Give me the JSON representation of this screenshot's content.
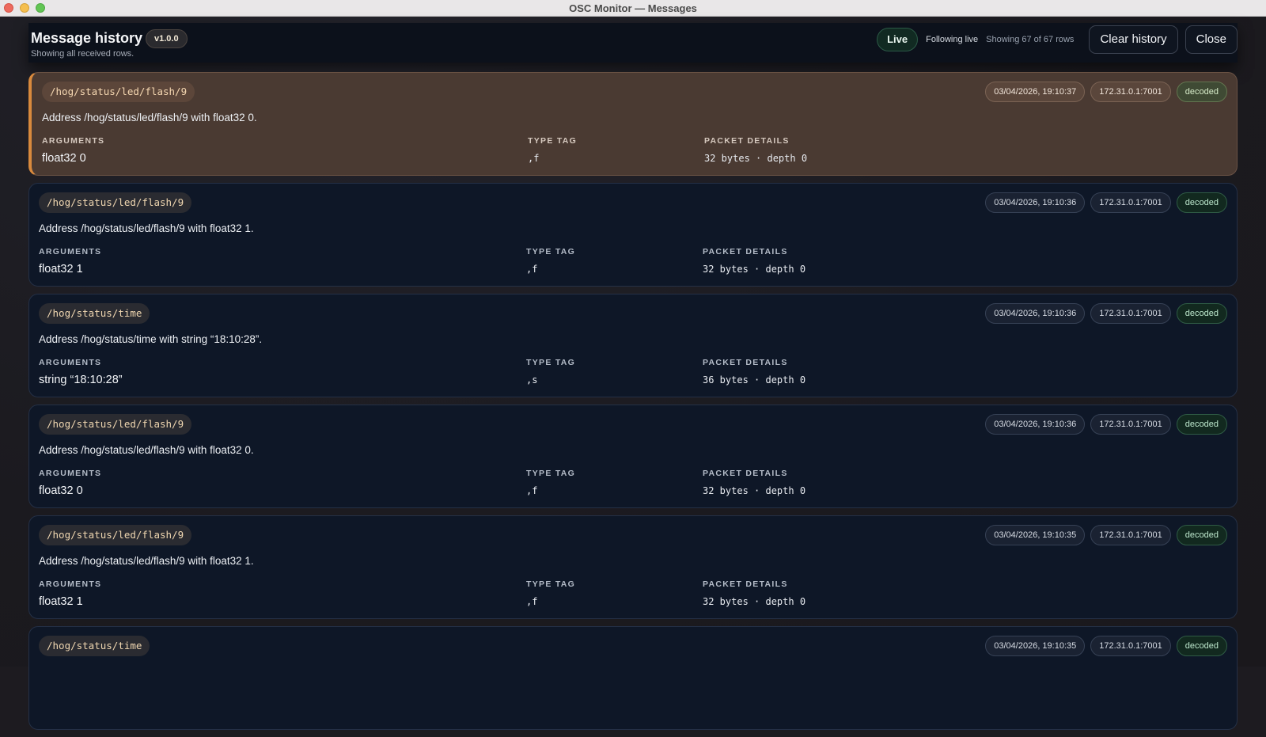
{
  "window": {
    "title": "OSC Monitor — Messages"
  },
  "header": {
    "title": "Message history",
    "version": "v1.0.0",
    "subtitle": "Showing all received rows.",
    "live_label": "Live",
    "following_label": "Following live",
    "showing_label": "Showing 67 of 67 rows",
    "clear_label": "Clear history",
    "close_label": "Close"
  },
  "columns": {
    "arguments": "ARGUMENTS",
    "type_tag": "TYPE TAG",
    "packet_details": "PACKET DETAILS"
  },
  "messages": [
    {
      "address": "/hog/status/led/flash/9",
      "timestamp": "03/04/2026, 19:10:37",
      "source": "172.31.0.1:7001",
      "status": "decoded",
      "description": "Address /hog/status/led/flash/9 with float32 0.",
      "arguments": "float32 0",
      "type_tag": ",f",
      "packet": "32 bytes · depth 0"
    },
    {
      "address": "/hog/status/led/flash/9",
      "timestamp": "03/04/2026, 19:10:36",
      "source": "172.31.0.1:7001",
      "status": "decoded",
      "description": "Address /hog/status/led/flash/9 with float32 1.",
      "arguments": "float32 1",
      "type_tag": ",f",
      "packet": "32 bytes · depth 0"
    },
    {
      "address": "/hog/status/time",
      "timestamp": "03/04/2026, 19:10:36",
      "source": "172.31.0.1:7001",
      "status": "decoded",
      "description": "Address /hog/status/time with string “18:10:28”.",
      "arguments": "string “18:10:28”",
      "type_tag": ",s",
      "packet": "36 bytes · depth 0"
    },
    {
      "address": "/hog/status/led/flash/9",
      "timestamp": "03/04/2026, 19:10:36",
      "source": "172.31.0.1:7001",
      "status": "decoded",
      "description": "Address /hog/status/led/flash/9 with float32 0.",
      "arguments": "float32 0",
      "type_tag": ",f",
      "packet": "32 bytes · depth 0"
    },
    {
      "address": "/hog/status/led/flash/9",
      "timestamp": "03/04/2026, 19:10:35",
      "source": "172.31.0.1:7001",
      "status": "decoded",
      "description": "Address /hog/status/led/flash/9 with float32 1.",
      "arguments": "float32 1",
      "type_tag": ",f",
      "packet": "32 bytes · depth 0"
    },
    {
      "address": "/hog/status/time",
      "timestamp": "03/04/2026, 19:10:35",
      "source": "172.31.0.1:7001",
      "status": "decoded",
      "description": "",
      "arguments": "",
      "type_tag": "",
      "packet": ""
    }
  ],
  "colors": {
    "accent": "#d98a3d",
    "card_bg": "#0e1727",
    "active_bg": "#4a3a32",
    "status_green": "#12291f"
  }
}
